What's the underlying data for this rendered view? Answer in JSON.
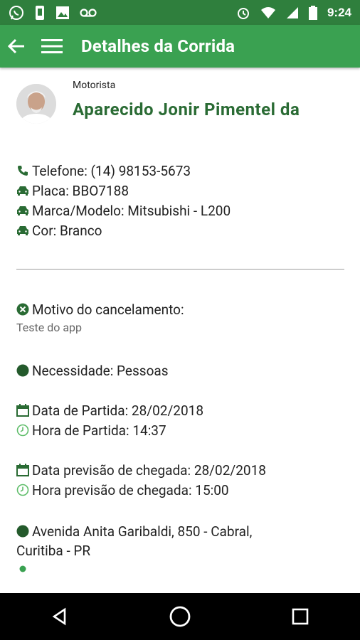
{
  "status_bar": {
    "time": "9:24",
    "icons": [
      "whatsapp-icon",
      "phone-icon",
      "image-icon",
      "voicemail-icon",
      "alarm-icon",
      "wifi-icon",
      "signal-icon",
      "battery-icon"
    ]
  },
  "appbar": {
    "title": "Detalhes da Corrida",
    "back_icon": "arrow-back-icon",
    "menu_icon": "hamburger-menu-icon"
  },
  "driver": {
    "label": "Motorista",
    "name": "Aparecido Jonir Pimentel da"
  },
  "info": {
    "telefone": "Telefone: (14) 98153-5673",
    "placa": "Placa: BBO7188",
    "marca_modelo": "Marca/Modelo: Mitsubishi - L200",
    "cor": "Cor: Branco"
  },
  "cancel": {
    "label": "Motivo do cancelamento:",
    "value": "Teste do app"
  },
  "necessidade": "Necessidade: Pessoas",
  "partida": {
    "data": "Data de Partida: 28/02/2018",
    "hora": "Hora de Partida: 14:37"
  },
  "chegada": {
    "data": "Data previsão de chegada: 28/02/2018",
    "hora": "Hora previsão de chegada: 15:00"
  },
  "endereco": {
    "line1": "Avenida Anita Garibaldi, 850 - Cabral,",
    "line2": "Curitiba - PR"
  },
  "colors": {
    "primary": "#3aa151",
    "status": "#2f7f3d",
    "accent": "#2a6b34"
  }
}
